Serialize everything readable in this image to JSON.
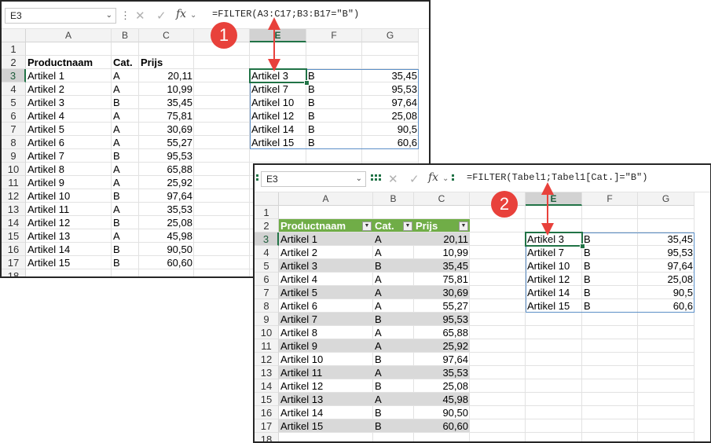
{
  "windows": [
    {
      "id": "w1",
      "name_box": "E3",
      "formula": "=FILTER(A3:C17;B3:B17=\"B\")",
      "columns": [
        "A",
        "B",
        "C",
        "D",
        "E",
        "F",
        "G"
      ],
      "selected_column": "E",
      "selected_row": "3",
      "rows": [
        "1",
        "2",
        "3",
        "4",
        "5",
        "6",
        "7",
        "8",
        "9",
        "10",
        "11",
        "12",
        "13",
        "14",
        "15",
        "16",
        "17",
        "18"
      ],
      "callout": "1",
      "source": {
        "header": [
          "Productnaam",
          "Cat.",
          "Prijs"
        ],
        "rows": [
          [
            "Artikel 1",
            "A",
            "20,11"
          ],
          [
            "Artikel 2",
            "A",
            "10,99"
          ],
          [
            "Artikel 3",
            "B",
            "35,45"
          ],
          [
            "Artikel 4",
            "A",
            "75,81"
          ],
          [
            "Artikel 5",
            "A",
            "30,69"
          ],
          [
            "Artikel 6",
            "A",
            "55,27"
          ],
          [
            "Artikel 7",
            "B",
            "95,53"
          ],
          [
            "Artikel 8",
            "A",
            "65,88"
          ],
          [
            "Artikel 9",
            "A",
            "25,92"
          ],
          [
            "Artikel 10",
            "B",
            "97,64"
          ],
          [
            "Artikel 11",
            "A",
            "35,53"
          ],
          [
            "Artikel 12",
            "B",
            "25,08"
          ],
          [
            "Artikel 13",
            "A",
            "45,98"
          ],
          [
            "Artikel 14",
            "B",
            "90,50"
          ],
          [
            "Artikel 15",
            "B",
            "60,60"
          ]
        ]
      },
      "result": [
        [
          "Artikel 3",
          "B",
          "35,45"
        ],
        [
          "Artikel 7",
          "B",
          "95,53"
        ],
        [
          "Artikel 10",
          "B",
          "97,64"
        ],
        [
          "Artikel 12",
          "B",
          "25,08"
        ],
        [
          "Artikel 14",
          "B",
          "90,5"
        ],
        [
          "Artikel 15",
          "B",
          "60,6"
        ]
      ]
    },
    {
      "id": "w2",
      "name_box": "E3",
      "formula": "=FILTER(Tabel1;Tabel1[Cat.]=\"B\")",
      "columns": [
        "A",
        "B",
        "C",
        "D",
        "E",
        "F",
        "G"
      ],
      "selected_column": "E",
      "selected_row": "3",
      "rows": [
        "1",
        "2",
        "3",
        "4",
        "5",
        "6",
        "7",
        "8",
        "9",
        "10",
        "11",
        "12",
        "13",
        "14",
        "15",
        "16",
        "17",
        "18"
      ],
      "callout": "2",
      "source": {
        "header": [
          "Productnaam",
          "Cat.",
          "Prijs"
        ],
        "rows": [
          [
            "Artikel 1",
            "A",
            "20,11"
          ],
          [
            "Artikel 2",
            "A",
            "10,99"
          ],
          [
            "Artikel 3",
            "B",
            "35,45"
          ],
          [
            "Artikel 4",
            "A",
            "75,81"
          ],
          [
            "Artikel 5",
            "A",
            "30,69"
          ],
          [
            "Artikel 6",
            "A",
            "55,27"
          ],
          [
            "Artikel 7",
            "B",
            "95,53"
          ],
          [
            "Artikel 8",
            "A",
            "65,88"
          ],
          [
            "Artikel 9",
            "A",
            "25,92"
          ],
          [
            "Artikel 10",
            "B",
            "97,64"
          ],
          [
            "Artikel 11",
            "A",
            "35,53"
          ],
          [
            "Artikel 12",
            "B",
            "25,08"
          ],
          [
            "Artikel 13",
            "A",
            "45,98"
          ],
          [
            "Artikel 14",
            "B",
            "90,50"
          ],
          [
            "Artikel 15",
            "B",
            "60,60"
          ]
        ]
      },
      "result": [
        [
          "Artikel 3",
          "B",
          "35,45"
        ],
        [
          "Artikel 7",
          "B",
          "95,53"
        ],
        [
          "Artikel 10",
          "B",
          "97,64"
        ],
        [
          "Artikel 12",
          "B",
          "25,08"
        ],
        [
          "Artikel 14",
          "B",
          "90,5"
        ],
        [
          "Artikel 15",
          "B",
          "60,6"
        ]
      ]
    }
  ],
  "icons": {
    "cancel": "x-icon",
    "confirm": "check-icon",
    "function": "fx-icon",
    "name_box_dropdown": "chevron-down-icon",
    "more": "more-vertical-icon",
    "filter": "filter-dropdown-icon"
  },
  "colors": {
    "table_header": "#70ad47",
    "table_band": "#d9d9d9",
    "selection": "#217346",
    "spill_border": "#5b8fc7",
    "callout": "#e8413b"
  }
}
